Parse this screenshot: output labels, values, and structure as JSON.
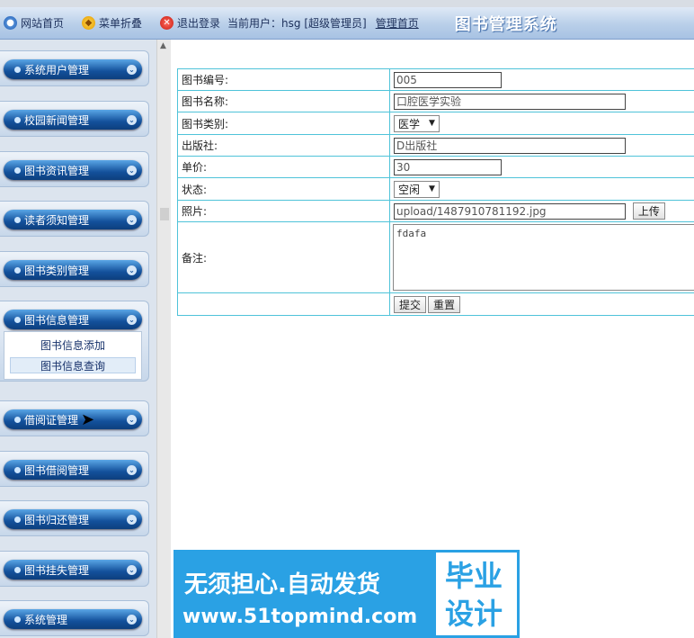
{
  "topbar": {
    "home": "网站首页",
    "fold": "菜单折叠",
    "logout": "退出登录",
    "user": "当前用户：hsg [超级管理员]",
    "admin_home": "管理首页",
    "system_title": "图书管理系统"
  },
  "sidebar": {
    "menus": [
      "系统用户管理",
      "校园新闻管理",
      "图书资讯管理",
      "读者须知管理",
      "图书类别管理",
      "图书信息管理",
      "借阅证管理",
      "图书借阅管理",
      "图书归还管理",
      "图书挂失管理",
      "系统管理"
    ],
    "submenu": [
      "图书信息添加",
      "图书信息查询"
    ]
  },
  "form": {
    "fields": {
      "id_label": "图书编号:",
      "id_value": "005",
      "name_label": "图书名称:",
      "name_value": "口腔医学实验",
      "category_label": "图书类别:",
      "category_value": "医学",
      "publisher_label": "出版社:",
      "publisher_value": "D出版社",
      "price_label": "单价:",
      "price_value": "30",
      "status_label": "状态:",
      "status_value": "空闲",
      "photo_label": "照片:",
      "photo_value": "upload/1487910781192.jpg",
      "upload_label": "上传",
      "note_label": "备注:",
      "note_value": "fdafa",
      "submit_label": "提交",
      "reset_label": "重置"
    }
  },
  "banner": {
    "line1": "无须担心.自动发货",
    "line2": "www.51topmind.com",
    "box_top": "毕业",
    "box_bottom": "设计"
  }
}
